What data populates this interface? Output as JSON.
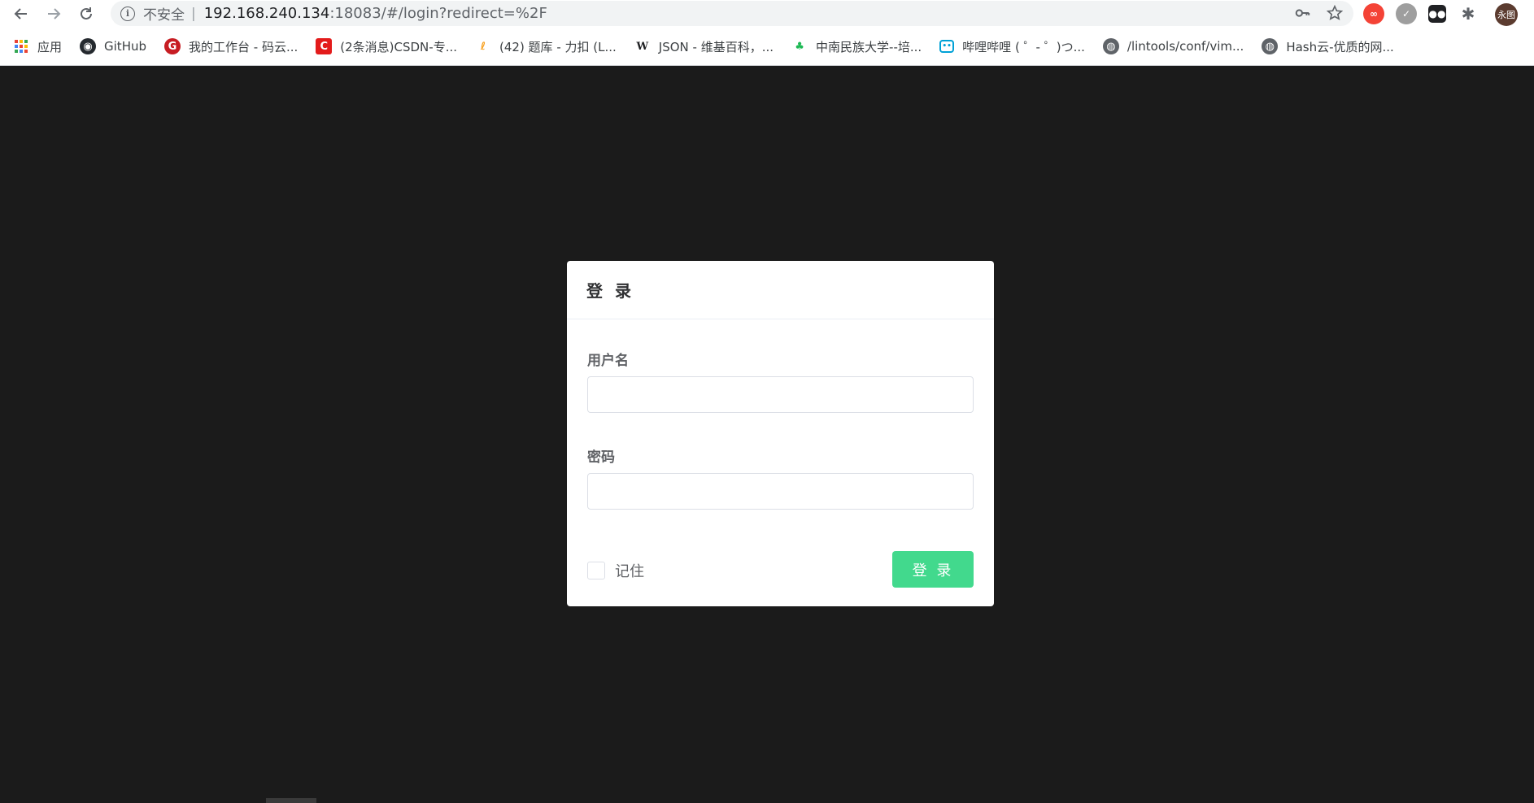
{
  "browser": {
    "url_insecure_label": "不安全",
    "url_separator": "|",
    "url_host": "192.168.240.134",
    "url_rest": ":18083/#/login?redirect=%2F",
    "avatar_text": "永图",
    "bookmarks": [
      {
        "label": "应用",
        "icon": "apps-grid-icon"
      },
      {
        "label": "GitHub",
        "icon": "github-icon"
      },
      {
        "label": "我的工作台 - 码云...",
        "icon": "gitee-icon"
      },
      {
        "label": "(2条消息)CSDN-专...",
        "icon": "csdn-icon"
      },
      {
        "label": "(42) 题库 - 力扣 (L...",
        "icon": "leetcode-icon"
      },
      {
        "label": "JSON - 维基百科，...",
        "icon": "wikipedia-icon"
      },
      {
        "label": "中南民族大学--培...",
        "icon": "university-icon"
      },
      {
        "label": "哔哩哔哩 ( ゜- ゜)つ...",
        "icon": "bilibili-icon"
      },
      {
        "label": "/lintools/conf/vim...",
        "icon": "globe-icon"
      },
      {
        "label": "Hash云-优质的网...",
        "icon": "globe-icon"
      }
    ]
  },
  "login": {
    "title": "登 录",
    "username_label": "用户名",
    "password_label": "密码",
    "remember_label": "记住",
    "submit_label": "登 录"
  },
  "colors": {
    "page_background": "#1b1b1b",
    "primary_button": "#42d98d"
  }
}
